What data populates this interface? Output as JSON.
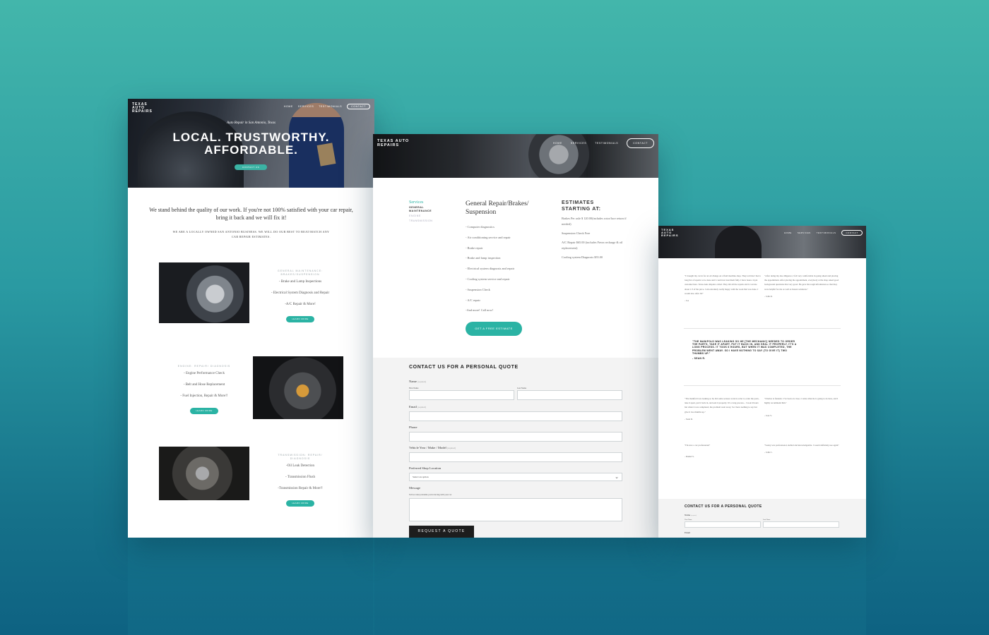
{
  "brand": "TEXAS AUTO REPAIRS",
  "nav": {
    "items": [
      "HOME",
      "SERVICES",
      "TESTIMONIALS"
    ],
    "contact": "CONTACT"
  },
  "home": {
    "tagline": "Auto Repair in San Antonio, Texas",
    "headline": "LOCAL. TRUSTWORTHY. AFFORDABLE.",
    "cta": "CONTACT US",
    "intro": "We stand behind the quality of our work. If you're not 100% satisfied with your car repair, bring it back and we will fix it!",
    "intro_small": "WE ARE A LOCALLY OWNED SAN ANTONIO BUSINESS. WE WILL DO OUR BEST TO BEAT/MATCH ANY CAR REPAIR ESTIMATES.",
    "services": [
      {
        "caption": "GENERAL MAINTENANCE: BRAKES/SUSPENSION",
        "items": [
          "- Brake and Lamp Inspections",
          "- Electrical System Diagnosis and Repair",
          "-A/C Repair & More!"
        ],
        "button": "LEARN MORE"
      },
      {
        "caption": "ENGINE: REPAIR/ DIAGNOSIS",
        "items": [
          "- Engine Performance Check",
          "- Belt and Hose Replacement",
          "- Fuel Injection, Repair & More!!"
        ],
        "button": "LEARN MORE"
      },
      {
        "caption": "TRANSMISSION: REPAIR/ DIAGNOSIS",
        "items": [
          "-Oil Leak Detection",
          "- Transmission Flush",
          "-Transmission Repair & More!!"
        ],
        "button": "LEARN MORE"
      }
    ]
  },
  "services_page": {
    "nav_title": "Services",
    "nav_active": "GENERAL MAINTENANCE",
    "nav_items": [
      "ENGINE",
      "TRANSMISSION"
    ],
    "title": "General Repair/Brakes/ Suspension",
    "items": [
      "- Computer diagnostics",
      "- Air conditioning service and repair",
      "- Brake repair",
      "- Brake and lamp inspection",
      "- Electrical system diagnosis and repair",
      "- Cooling system service and repair",
      "- Suspension Check",
      "- A/C repair",
      "-And more! Call now!"
    ],
    "estimate_button": "GET A FREE ESTIMATE",
    "estimates_title": "ESTIMATES STARTING AT:",
    "estimates": [
      "Brakes Per axle $ 120.00(includes rotor/face return if needed)",
      "Suspension Check Free",
      "A/C Repair $65.00 (includes Freon recharge & oil replacement)",
      "Cooling system Diagnosis $55.00"
    ]
  },
  "form": {
    "title": "CONTACT US FOR A PERSONAL QUOTE",
    "required": "(required)",
    "name_label": "Name",
    "first_name": "First Name",
    "last_name": "Last Name",
    "email_label": "Email",
    "phone_label": "Phone",
    "vehicle_label": "Vehicle Year / Make / Model",
    "location_label": "Preferred Shop Location",
    "location_value": "Select an option",
    "message_label": "Message",
    "message_hint": "Tell us what problems you're having with your car",
    "submit": "REQUEST A QUOTE"
  },
  "testimonials": {
    "quotes": [
      {
        "text": "\"I brought my car in for an oil change on a fluid machine shop. They told me I had a long list of repairs to be done and I could not trust them fully. I have been a loyal customer here. Texas Auto Repairs called. They did all the repairs and it cost me about 1/3 of the price. I am extremely really happy with the work that was done. I would also refer. Dr\"",
        "name": "- Joe"
      },
      {
        "text": "\"After doing my due diligence, I felt very comfortable in going ahead and placing the appointment. After placing the appointment, everybody at the shop asked good background questions that very good. He gave his tough information so that they were helpful for me as well as honest solutions.\"",
        "name": "- John R."
      },
      {
        "text": "\"THE MANIFOLD WAS LEAKING SO HE [THE MECHANIC] NEEDED TO ORDER THE PARTS, TAKE IT APART, PUT IT BACK IN, AND SEAL IT PROPERLY. IT'S A LONG PROCESS. IT TOOK 6 HOURS, BUT WHEN IT WAS COMPLETED, THE PROBLEM WENT AWAY. SO I HAVE NOTHING TO SAY (TO GIVE IT) TWO THUMBS UP.\"",
        "name": "- SEAN R."
      },
      {
        "text": "\"The manifold was leaking so he did some serious work in order to order the parts, take it apart, put it back in, and seal it properly. It's a long process... I took 6 hours but when it was completed, the problem went away. So I have nothing to say but give it two thumbs up.\"",
        "name": "- Sean R."
      },
      {
        "text": "\"Charles is fantastic. I've been on close, I came when he is going to do here, and I highly recommend him.\"",
        "name": "- Jose V."
      },
      {
        "text": "\"I'm now a car professional\"",
        "name": "- Daniel S."
      },
      {
        "text": "\"Sonny was professional, skilled and knowledgeable. I would definitely use again\"",
        "name": "- John C."
      }
    ]
  },
  "colors": {
    "teal": "#2bb3a4",
    "dark": "#1d1d1d",
    "form_bg": "#f3f3f3"
  }
}
